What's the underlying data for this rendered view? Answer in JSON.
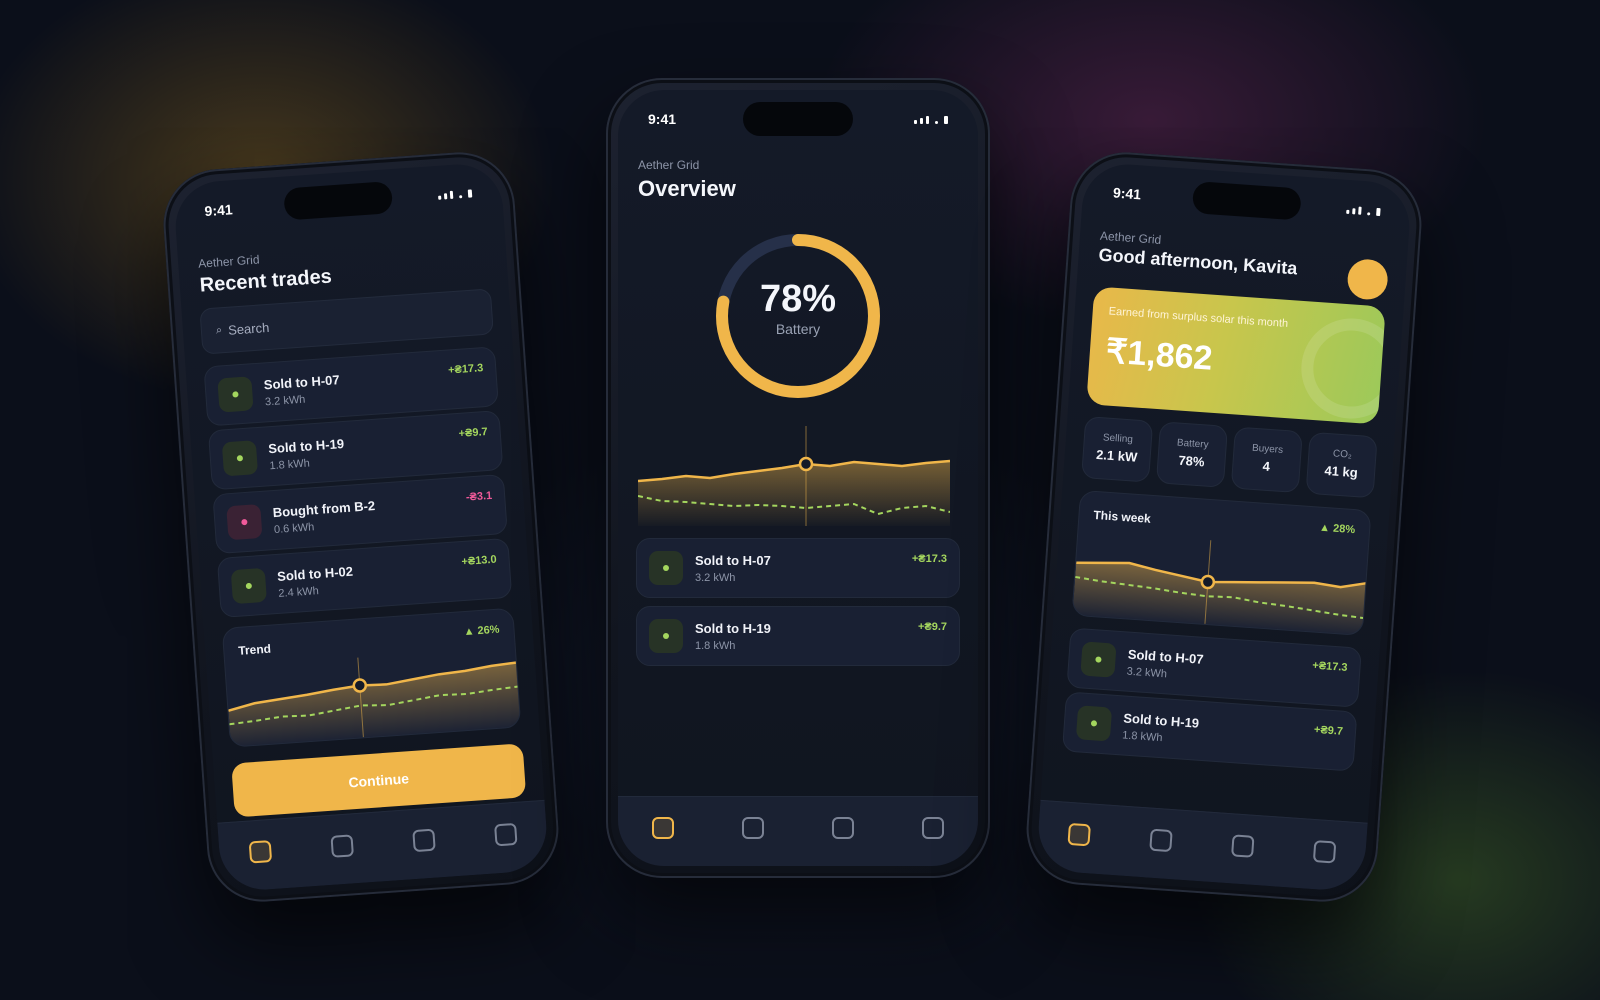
{
  "status": {
    "time": "9:41"
  },
  "brand": "Aether Grid",
  "phone_left": {
    "title": "Recent trades",
    "search_placeholder": "Search",
    "search_icon": "search-icon",
    "trades": [
      {
        "label": "Sold to H-07",
        "qty": "3.2 kWh",
        "amount": "+₴17.3",
        "type": "sell"
      },
      {
        "label": "Sold to H-19",
        "qty": "1.8 kWh",
        "amount": "+₴9.7",
        "type": "sell"
      },
      {
        "label": "Bought from B-2",
        "qty": "0.6 kWh",
        "amount": "-₴3.1",
        "type": "buy"
      },
      {
        "label": "Sold to H-02",
        "qty": "2.4 kWh",
        "amount": "+₴13.0",
        "type": "sell"
      }
    ],
    "chart_title": "Trend",
    "chart_change": "▲ 26%",
    "button": "Continue"
  },
  "phone_center": {
    "title": "Overview",
    "battery_percent": "78%",
    "battery_level": 0.78,
    "battery_label": "Battery",
    "trades": [
      {
        "label": "Sold to H-07",
        "qty": "3.2 kWh",
        "amount": "+₴17.3",
        "type": "sell"
      },
      {
        "label": "Sold to H-19",
        "qty": "1.8 kWh",
        "amount": "+₴9.7",
        "type": "sell"
      }
    ]
  },
  "phone_right": {
    "greeting": "Good afternoon, Kavita",
    "earn_label": "Earned from surplus solar this month",
    "earn_value": "₹1,862",
    "stats": [
      {
        "label": "Selling",
        "value": "2.1 kW"
      },
      {
        "label": "Battery",
        "value": "78%"
      },
      {
        "label": "Buyers",
        "value": "4"
      },
      {
        "label": "CO₂",
        "value": "41 kg"
      }
    ],
    "chart_title": "This week",
    "chart_change": "▲ 28%",
    "trades": [
      {
        "label": "Sold to H-07",
        "qty": "3.2 kWh",
        "amount": "+₴17.3",
        "type": "sell"
      },
      {
        "label": "Sold to H-19",
        "qty": "1.8 kWh",
        "amount": "+₴9.7",
        "type": "sell"
      }
    ]
  },
  "tabs": [
    "home-tab-icon",
    "trades-tab-icon",
    "stats-tab-icon",
    "profile-tab-icon"
  ],
  "colors": {
    "accent": "#f0b64a",
    "positive": "#a4d65e",
    "negative": "#f05a9a",
    "background": "#0b0f1a"
  }
}
